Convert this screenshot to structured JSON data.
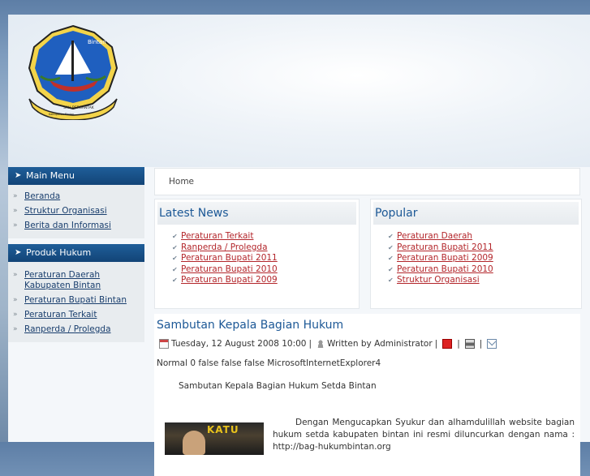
{
  "logo": {
    "text": "Bintan",
    "motto": "SAH BERSANTAK",
    "banner": "Kabupaten Bintan"
  },
  "sidebar": {
    "main_menu": {
      "title": "Main Menu",
      "items": [
        "Beranda",
        "Struktur Organisasi",
        "Berita dan Informasi"
      ]
    },
    "produk_hukum": {
      "title": "Produk Hukum",
      "items": [
        "Peraturan Daerah Kabupaten Bintan",
        "Peraturan Bupati Bintan",
        "Peraturan Terkait",
        "Ranperda / Prolegda"
      ]
    }
  },
  "breadcrumb": "Home",
  "latest_news": {
    "title": "Latest News",
    "items": [
      "Peraturan Terkait",
      "Ranperda / Prolegda",
      "Peraturan Bupati 2011",
      "Peraturan Bupati 2010",
      "Peraturan Bupati 2009"
    ]
  },
  "popular": {
    "title": "Popular",
    "items": [
      "Peraturan Daerah",
      "Peraturan Bupati 2011",
      "Peraturan Bupati 2009",
      "Peraturan Bupati 2010",
      "Struktur Organisasi"
    ]
  },
  "article": {
    "title": "Sambutan Kepala Bagian Hukum",
    "date": "Tuesday, 12 August 2008 10:00",
    "author": "Written by Administrator",
    "line1": "Normal 0 false false false MicrosoftInternetExplorer4",
    "line2": "Sambutan Kepala Bagian Hukum Setda Bintan",
    "paragraph": "Dengan Mengucapkan Syukur dan alhamdulillah website bagian hukum setda kabupaten bintan ini resmi diluncurkan dengan nama : http://bag-hukumbintan.org",
    "photo_banner": "KATU"
  },
  "colors": {
    "accent": "#1c5896",
    "link_red": "#b3262b",
    "menu_head": "#1a4f86"
  }
}
